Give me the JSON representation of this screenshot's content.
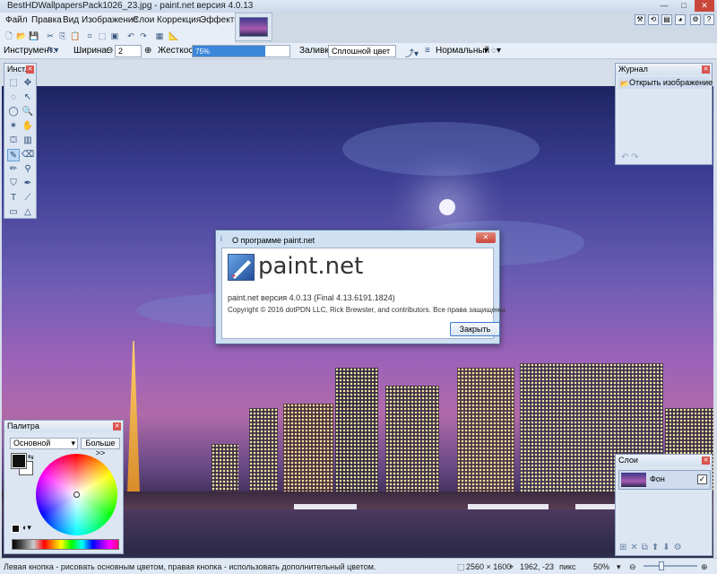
{
  "window": {
    "title": "BestHDWallpapersPack1026_23.jpg - paint.net версия 4.0.13",
    "minimize_icon": "minimize-icon",
    "maximize_icon": "maximize-icon",
    "close_icon": "close-icon"
  },
  "menu": {
    "items": [
      "Файл",
      "Правка",
      "Вид",
      "Изображение",
      "Слои",
      "Коррекция",
      "Эффекты"
    ]
  },
  "toolbar": {
    "tool_label": "Инструмент:",
    "width_label": "Ширина:",
    "width_value": "2",
    "hardness_label": "Жесткость:",
    "hardness_value": "75%",
    "hardness_fraction": 0.75,
    "fill_label": "Заливка:",
    "fill_value": "Сплошной цвет",
    "blend_value": "Нормальный"
  },
  "tools_panel": {
    "title": "Инст..."
  },
  "history_panel": {
    "title": "Журнал",
    "items": [
      "Открыть изображение"
    ]
  },
  "palette_panel": {
    "title": "Палитра",
    "mode": "Основной",
    "more_button": "Больше >>"
  },
  "layers_panel": {
    "title": "Слои",
    "layers": [
      {
        "name": "Фон",
        "visible": true
      }
    ]
  },
  "about_dialog": {
    "title": "О программе paint.net",
    "logo_text": "paint.net",
    "version": "paint.net версия 4.0.13 (Final 4.13.6191.1824)",
    "copyright": "Copyright © 2016 dotPDN LLC, Rick Brewster, and contributors. Все права защищены.",
    "close_button": "Закрыть"
  },
  "status": {
    "hint": "Левая кнопка - рисовать основным цветом, правая кнопка - использовать дополнительный цветом.",
    "image_size": "2560 × 1600",
    "cursor_pos": "1962, -23",
    "units": "пикс",
    "zoom": "50%"
  },
  "colors": {
    "accent": "#3b86d8",
    "primary_color": "#111111",
    "secondary_color": "#ffffff"
  }
}
